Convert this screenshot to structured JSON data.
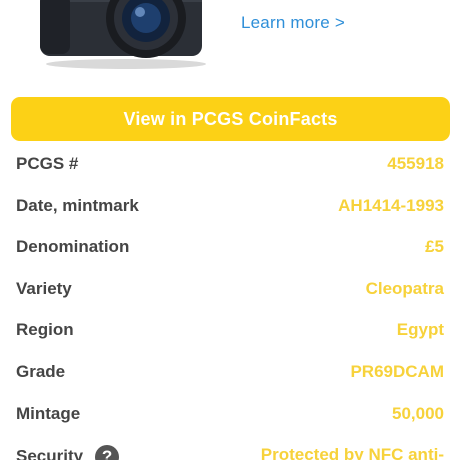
{
  "ad": {
    "learn_more": "Learn more >",
    "camera_icon": "camera-icon"
  },
  "cta": {
    "label": "View in PCGS CoinFacts"
  },
  "colors": {
    "accent": "#fcd116",
    "value": "#f7d23b",
    "label": "#454545",
    "link": "#2f8fd8"
  },
  "details": [
    {
      "label": "PCGS #",
      "value": "455918"
    },
    {
      "label": "Date, mintmark",
      "value": "AH1414-1993"
    },
    {
      "label": "Denomination",
      "value": "£5"
    },
    {
      "label": "Variety",
      "value": "Cleopatra"
    },
    {
      "label": "Region",
      "value": "Egypt"
    },
    {
      "label": "Grade",
      "value": "PR69DCAM"
    },
    {
      "label": "Mintage",
      "value": "50,000"
    },
    {
      "label": "Security",
      "value": "Protected by NFC anti-",
      "help": "?"
    }
  ]
}
